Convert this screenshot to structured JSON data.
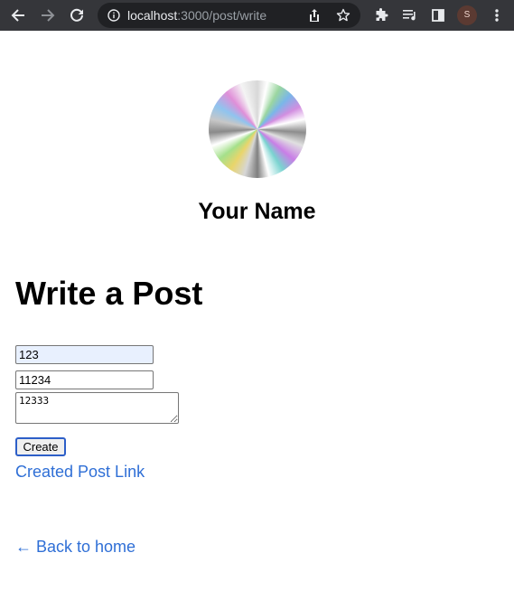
{
  "browser": {
    "url_host": "localhost",
    "url_path": ":3000/post/write",
    "profile_initial": "S"
  },
  "profile": {
    "name": "Your Name"
  },
  "page": {
    "heading": "Write a Post"
  },
  "form": {
    "title_value": "123",
    "date_value": "11234",
    "content_value": "12333",
    "create_label": "Create"
  },
  "links": {
    "created_post": "Created Post Link",
    "back_home": "← Back to home"
  }
}
